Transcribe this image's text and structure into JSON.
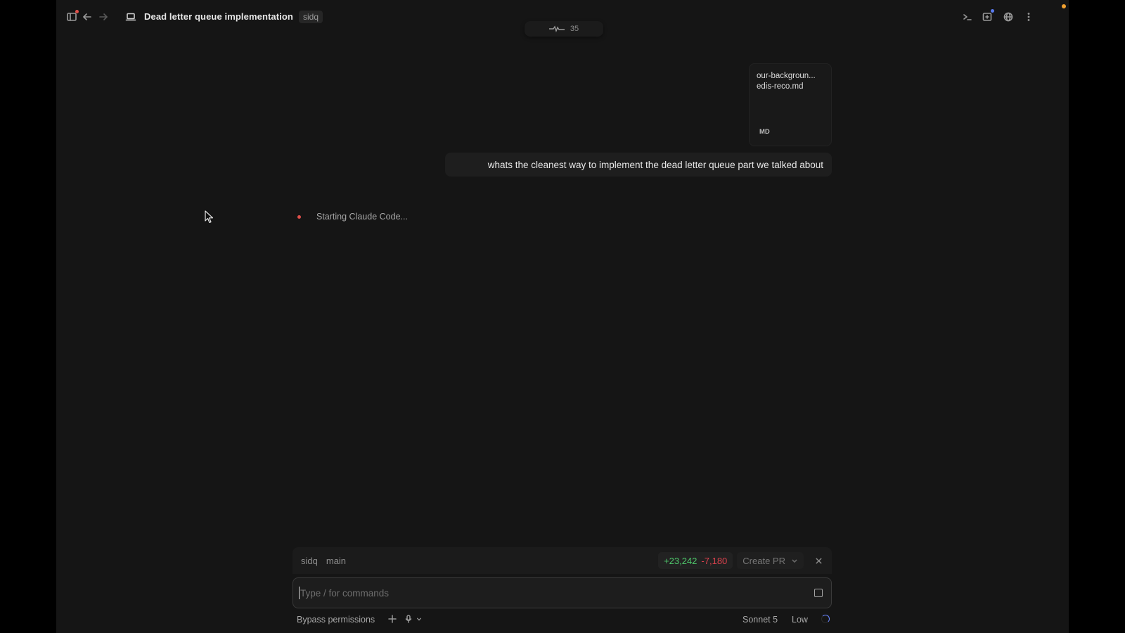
{
  "header": {
    "title": "Dead letter queue implementation",
    "repo_tag": "sidq",
    "activity_count": "35",
    "icons": [
      "sidebar-toggle-icon",
      "back-arrow-icon",
      "forward-arrow-icon",
      "laptop-icon",
      "terminal-icon",
      "new-window-icon",
      "globe-icon",
      "more-vertical-icon"
    ]
  },
  "attachment": {
    "name_line1": "our-backgroun...",
    "name_line2": "edis-reco.md",
    "type": "MD"
  },
  "messages": [
    {
      "role": "user",
      "text": "whats the cleanest way to implement the dead letter queue part we talked about"
    }
  ],
  "status": {
    "text": "Starting Claude Code..."
  },
  "branch_bar": {
    "repo": "sidq",
    "branch": "main",
    "additions": "+23,242",
    "deletions": "-7,180",
    "create_pr_label": "Create PR"
  },
  "composer": {
    "placeholder": "Type / for commands"
  },
  "footer": {
    "permissions": "Bypass permissions",
    "model": "Sonnet 5",
    "effort": "Low"
  },
  "colors": {
    "accent_red": "#e0504a",
    "accent_orange": "#f0a030",
    "additions": "#4ec66a",
    "deletions": "#d9414c",
    "spinner": "#6a86ff"
  }
}
